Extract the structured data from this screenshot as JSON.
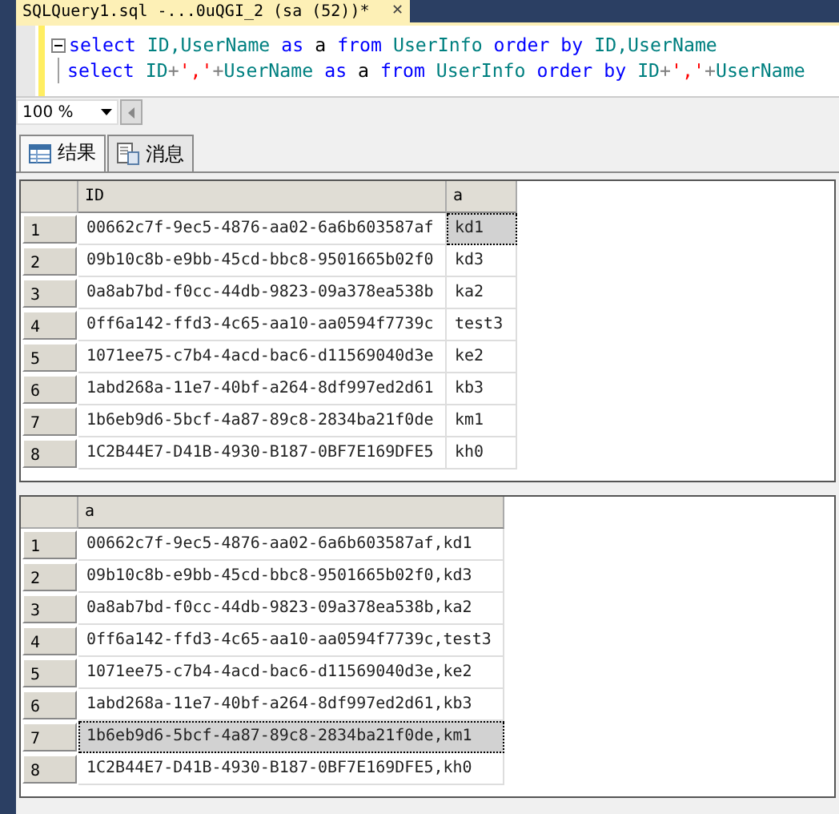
{
  "document_tab": {
    "title": "SQLQuery1.sql -...0uQGI_2 (sa (52))*",
    "close": "✕"
  },
  "editor": {
    "lines": [
      [
        {
          "text": "select",
          "kind": "keyword"
        },
        {
          "text": " ID,UserName ",
          "kind": "identifier"
        },
        {
          "text": "as",
          "kind": "keyword"
        },
        {
          "text": " a ",
          "kind": "plain"
        },
        {
          "text": "from",
          "kind": "keyword"
        },
        {
          "text": " UserInfo ",
          "kind": "identifier"
        },
        {
          "text": "order by",
          "kind": "keyword"
        },
        {
          "text": " ID,UserName",
          "kind": "identifier"
        }
      ],
      [
        {
          "text": "select",
          "kind": "keyword"
        },
        {
          "text": " ID",
          "kind": "identifier"
        },
        {
          "text": "+",
          "kind": "operator"
        },
        {
          "text": "','",
          "kind": "string"
        },
        {
          "text": "+",
          "kind": "operator"
        },
        {
          "text": "UserName ",
          "kind": "identifier"
        },
        {
          "text": "as",
          "kind": "keyword"
        },
        {
          "text": " a ",
          "kind": "plain"
        },
        {
          "text": "from",
          "kind": "keyword"
        },
        {
          "text": " UserInfo ",
          "kind": "identifier"
        },
        {
          "text": "order by",
          "kind": "keyword"
        },
        {
          "text": " ID",
          "kind": "identifier"
        },
        {
          "text": "+",
          "kind": "operator"
        },
        {
          "text": "','",
          "kind": "string"
        },
        {
          "text": "+",
          "kind": "operator"
        },
        {
          "text": "UserName",
          "kind": "identifier"
        }
      ]
    ]
  },
  "zoom": {
    "value": "100 %"
  },
  "result_tabs": [
    {
      "label": "结果",
      "kind": "grid",
      "selected": true
    },
    {
      "label": "消息",
      "kind": "messages",
      "selected": false
    }
  ],
  "grids": [
    {
      "columns": [
        "ID",
        "a"
      ],
      "rows": [
        {
          "num": "1",
          "cells": [
            {
              "text": "00662c7f-9ec5-4876-aa02-6a6b603587af",
              "selected": false
            },
            {
              "text": "kd1",
              "selected": true
            }
          ]
        },
        {
          "num": "2",
          "cells": [
            {
              "text": "09b10c8b-e9bb-45cd-bbc8-9501665b02f0",
              "selected": false
            },
            {
              "text": "kd3",
              "selected": false
            }
          ]
        },
        {
          "num": "3",
          "cells": [
            {
              "text": "0a8ab7bd-f0cc-44db-9823-09a378ea538b",
              "selected": false
            },
            {
              "text": "ka2",
              "selected": false
            }
          ]
        },
        {
          "num": "4",
          "cells": [
            {
              "text": "0ff6a142-ffd3-4c65-aa10-aa0594f7739c",
              "selected": false
            },
            {
              "text": "test3",
              "selected": false
            }
          ]
        },
        {
          "num": "5",
          "cells": [
            {
              "text": "1071ee75-c7b4-4acd-bac6-d11569040d3e",
              "selected": false
            },
            {
              "text": "ke2",
              "selected": false
            }
          ]
        },
        {
          "num": "6",
          "cells": [
            {
              "text": "1abd268a-11e7-40bf-a264-8df997ed2d61",
              "selected": false
            },
            {
              "text": "kb3",
              "selected": false
            }
          ]
        },
        {
          "num": "7",
          "cells": [
            {
              "text": "1b6eb9d6-5bcf-4a87-89c8-2834ba21f0de",
              "selected": false
            },
            {
              "text": "km1",
              "selected": false
            }
          ]
        },
        {
          "num": "8",
          "cells": [
            {
              "text": "1C2B44E7-D41B-4930-B187-0BF7E169DFE5",
              "selected": false
            },
            {
              "text": "kh0",
              "selected": false
            }
          ]
        }
      ]
    },
    {
      "columns": [
        "a"
      ],
      "rows": [
        {
          "num": "1",
          "cells": [
            {
              "text": "00662c7f-9ec5-4876-aa02-6a6b603587af,kd1",
              "selected": false
            }
          ]
        },
        {
          "num": "2",
          "cells": [
            {
              "text": "09b10c8b-e9bb-45cd-bbc8-9501665b02f0,kd3",
              "selected": false
            }
          ]
        },
        {
          "num": "3",
          "cells": [
            {
              "text": "0a8ab7bd-f0cc-44db-9823-09a378ea538b,ka2",
              "selected": false
            }
          ]
        },
        {
          "num": "4",
          "cells": [
            {
              "text": "0ff6a142-ffd3-4c65-aa10-aa0594f7739c,test3",
              "selected": false
            }
          ]
        },
        {
          "num": "5",
          "cells": [
            {
              "text": "1071ee75-c7b4-4acd-bac6-d11569040d3e,ke2",
              "selected": false
            }
          ]
        },
        {
          "num": "6",
          "cells": [
            {
              "text": "1abd268a-11e7-40bf-a264-8df997ed2d61,kb3",
              "selected": false
            }
          ]
        },
        {
          "num": "7",
          "cells": [
            {
              "text": "1b6eb9d6-5bcf-4a87-89c8-2834ba21f0de,km1",
              "selected": true
            }
          ]
        },
        {
          "num": "8",
          "cells": [
            {
              "text": "1C2B44E7-D41B-4930-B187-0BF7E169DFE5,kh0",
              "selected": false
            }
          ]
        }
      ]
    }
  ]
}
